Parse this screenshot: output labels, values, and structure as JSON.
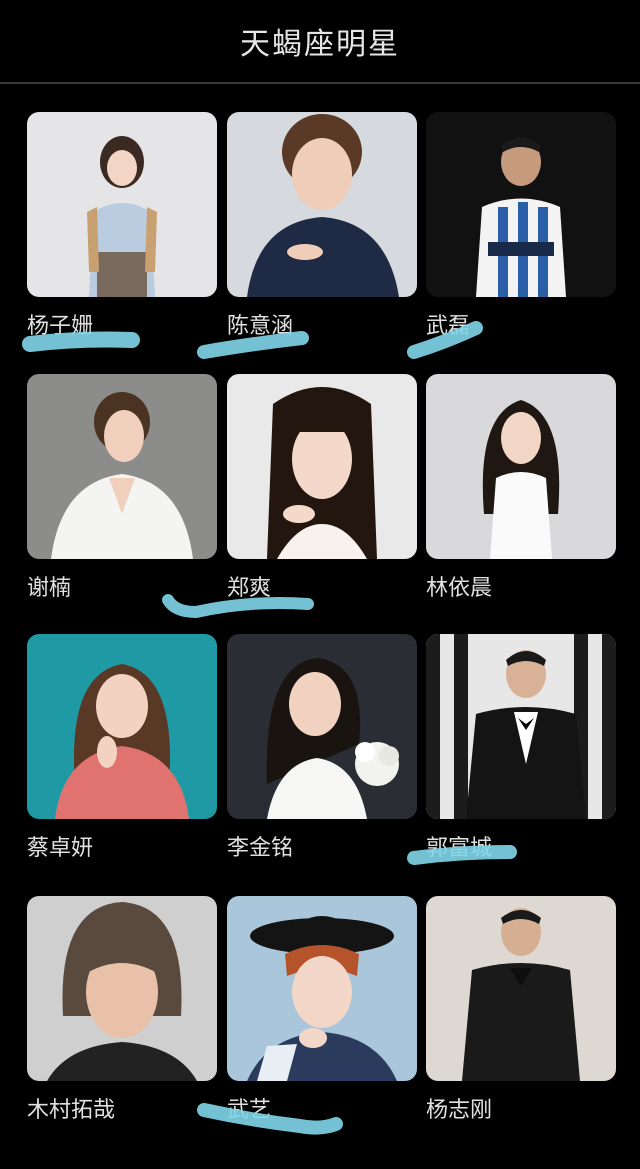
{
  "header": {
    "title": "天蝎座明星"
  },
  "cards": [
    {
      "name": "杨子姗"
    },
    {
      "name": "陈意涵"
    },
    {
      "name": "武磊"
    },
    {
      "name": "谢楠"
    },
    {
      "name": "郑爽"
    },
    {
      "name": "林依晨"
    },
    {
      "name": "蔡卓妍"
    },
    {
      "name": "李金铭"
    },
    {
      "name": "郭富城"
    },
    {
      "name": "木村拓哉"
    },
    {
      "name": "武艺"
    },
    {
      "name": "杨志刚"
    }
  ],
  "colors": {
    "background": "#000000",
    "text": "#e0e0e0",
    "highlight_marker": "#7fd6ea"
  }
}
